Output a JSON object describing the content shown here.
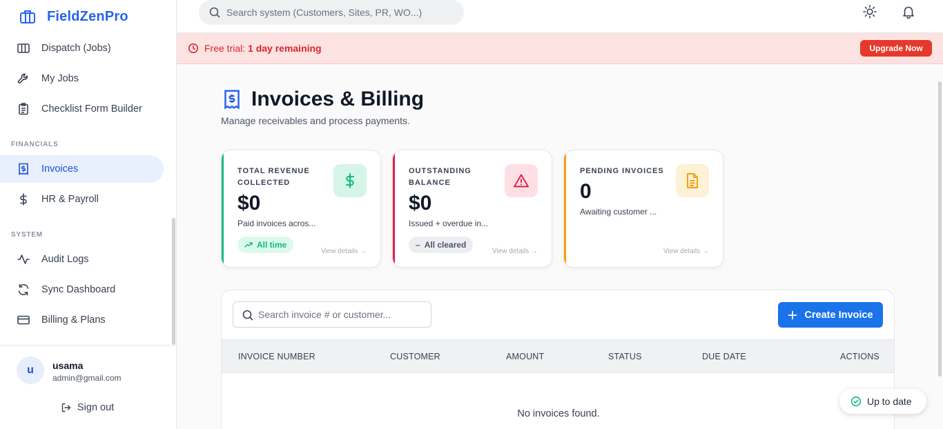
{
  "brand": {
    "name": "FieldZenPro",
    "color": "#2563eb"
  },
  "sidebar": {
    "items": [
      {
        "label": "Dispatch (Jobs)",
        "icon": "columns-icon"
      },
      {
        "label": "My Jobs",
        "icon": "wrench-icon"
      },
      {
        "label": "Checklist Form Builder",
        "icon": "clipboard-icon"
      },
      {
        "label": "Invoices",
        "icon": "receipt-icon",
        "active": true
      },
      {
        "label": "HR & Payroll",
        "icon": "dollar-icon"
      },
      {
        "label": "Audit Logs",
        "icon": "activity-icon"
      },
      {
        "label": "Sync Dashboard",
        "icon": "refresh-icon"
      },
      {
        "label": "Billing & Plans",
        "icon": "credit-card-icon"
      }
    ],
    "sections": {
      "financials": "FINANCIALS",
      "system": "SYSTEM"
    },
    "user": {
      "initial": "u",
      "name": "usama",
      "email": "admin@gmail.com"
    },
    "sign_out": "Sign out"
  },
  "topbar": {
    "search_placeholder": "Search system (Customers, Sites, PR, WO...)",
    "icons": [
      "sun-icon",
      "bell-icon"
    ]
  },
  "banner": {
    "prefix": "Free trial: ",
    "highlight": "1 day remaining",
    "button": "Upgrade Now",
    "colors": {
      "bg": "#fde2e2",
      "text": "#dc2626",
      "button": "#e5392b"
    }
  },
  "page": {
    "title": "Invoices & Billing",
    "subtitle": "Manage receivables and process payments."
  },
  "cards": [
    {
      "label": "TOTAL REVENUE COLLECTED",
      "value": "$0",
      "desc": "Paid invoices acros...",
      "badge": "All time",
      "link": "View details →",
      "accent": "#10b981"
    },
    {
      "label": "OUTSTANDING BALANCE",
      "value": "$0",
      "desc": "Issued + overdue in...",
      "badge": "All cleared",
      "link": "View details →",
      "accent": "#e11d48"
    },
    {
      "label": "PENDING INVOICES",
      "value": "0",
      "desc": "Awaiting customer ...",
      "link": "View details →",
      "accent": "#f59e0b"
    }
  ],
  "table": {
    "search_placeholder": "Search invoice # or customer...",
    "create_button": "Create Invoice",
    "columns": [
      "INVOICE NUMBER",
      "CUSTOMER",
      "AMOUNT",
      "STATUS",
      "DUE DATE",
      "ACTIONS"
    ],
    "empty_message": "No invoices found."
  },
  "status_pill": {
    "label": "Up to date"
  }
}
